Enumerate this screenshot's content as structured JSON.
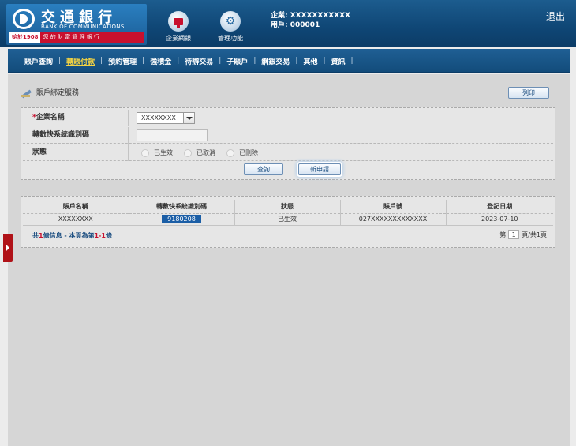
{
  "header": {
    "bank_cn": "交通銀行",
    "bank_en": "BANK OF COMMUNICATIONS",
    "since": "始於1908",
    "slogan": "您 的 財 富 管 理 銀 行",
    "nav_enterprise": "企業網銀",
    "nav_manage": "管理功能",
    "company_line": "企業: XXXXXXXXXXX",
    "user_line": "用戶: 000001",
    "logout": "退出"
  },
  "menu": {
    "items": [
      "賬戶查詢",
      "轉賬付款",
      "預約管理",
      "強積金",
      "待辦交易",
      "子賬戶",
      "網銀交易",
      "其他",
      "資訊"
    ],
    "active_index": 1
  },
  "page": {
    "title": "賬戶綁定服務",
    "print_label": "列印"
  },
  "form": {
    "company_label": "企業名稱",
    "company_required": "*",
    "company_value": "XXXXXXXX",
    "fps_label": "轉數快系統識別碼",
    "fps_value": "",
    "status_label": "狀態",
    "status_options": [
      "已生效",
      "已取消",
      "已刪除"
    ],
    "search_label": "查詢",
    "apply_label": "新申請"
  },
  "table": {
    "headers": [
      "賬戶名稱",
      "轉數快系統識別碼",
      "狀態",
      "賬戶號",
      "登記日期"
    ],
    "rows": [
      [
        "XXXXXXXX",
        "9180208",
        "已生效",
        "027XXXXXXXXXXXXX",
        "2023-07-10"
      ]
    ],
    "footer_a": "共",
    "footer_total": "1",
    "footer_b": "條信息 - 本頁為第",
    "footer_range": "1-1",
    "footer_c": "條",
    "pager_prefix": "第",
    "pager_page": "1",
    "pager_suffix": "頁/共1頁"
  },
  "colors": {
    "header_blue": "#0f4675",
    "brand_red": "#c8102e",
    "active_menu": "#f5d442",
    "chip_blue": "#1b5ea6"
  }
}
